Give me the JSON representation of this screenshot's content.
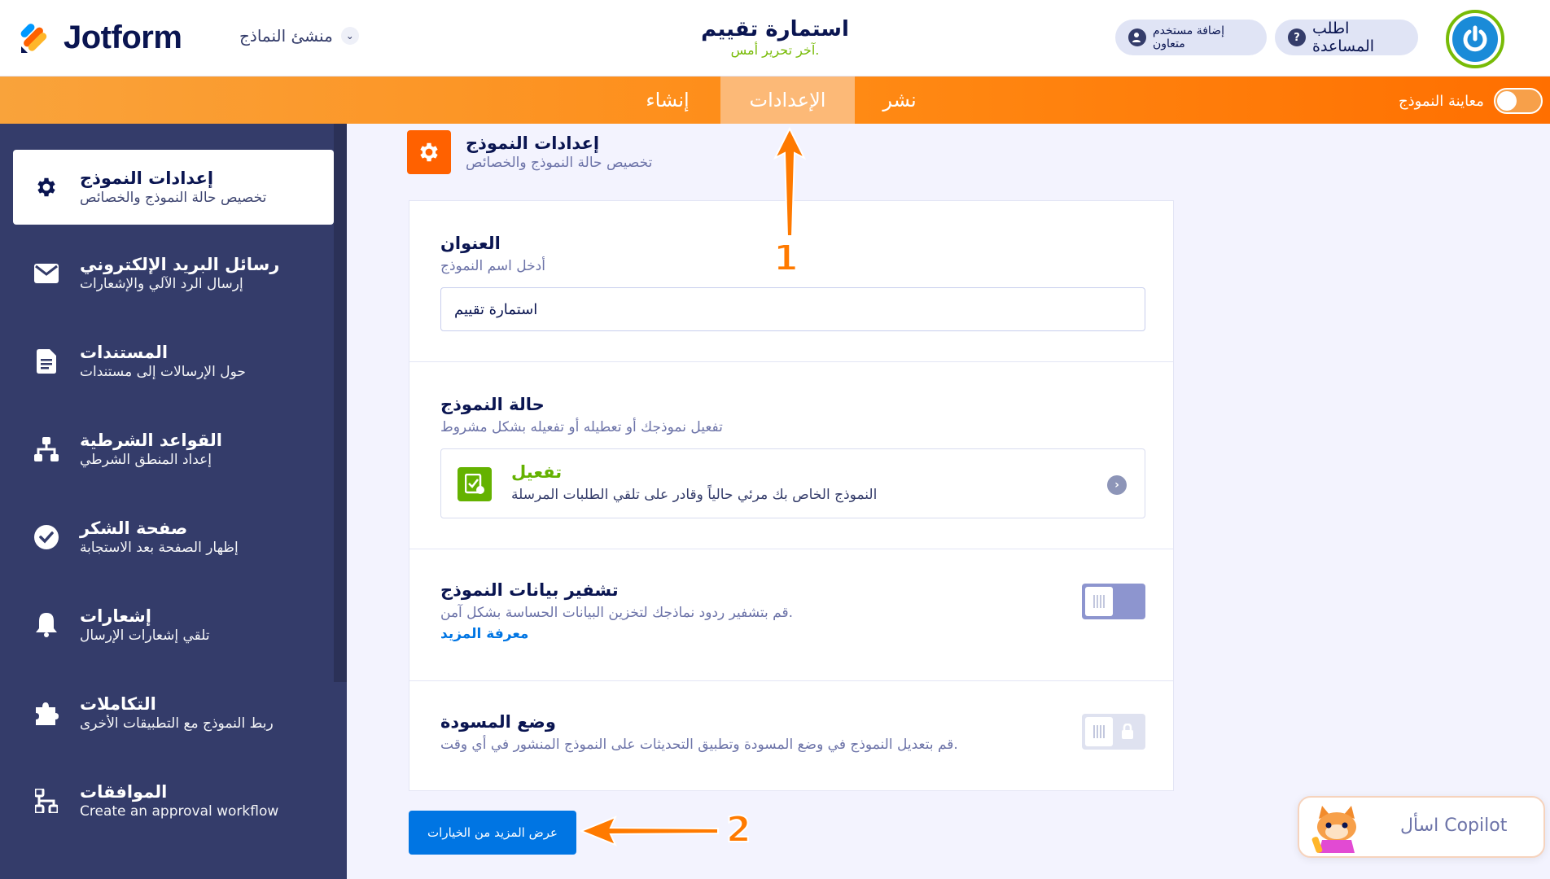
{
  "header": {
    "brand": "Jotform",
    "builder_label": "منشئ النماذج",
    "form_title": "استمارة تقييم",
    "last_edited": "آخر تحرير أمس.",
    "add_collaborator": "إضافة مستخدم متعاون",
    "get_help": "اطلب المساعدة"
  },
  "nav": {
    "tabs": [
      "إنشاء",
      "الإعدادات",
      "نشر"
    ],
    "preview_label": "معاينة النموذج"
  },
  "sidebar": {
    "items": [
      {
        "title": "إعدادات النموذج",
        "desc": "تخصيص حالة النموذج والخصائص",
        "icon": "gear-icon"
      },
      {
        "title": "رسائل البريد الإلكتروني",
        "desc": "إرسال الرد الآلي والإشعارات",
        "icon": "envelope-icon"
      },
      {
        "title": "المستندات",
        "desc": "حول الإرسالات إلى مستندات",
        "icon": "document-icon"
      },
      {
        "title": "القواعد الشرطية",
        "desc": "إعداد المنطق الشرطي",
        "icon": "hierarchy-icon"
      },
      {
        "title": "صفحة الشكر",
        "desc": "إظهار الصفحة بعد الاستجابة",
        "icon": "check-circle-icon"
      },
      {
        "title": "إشعارات",
        "desc": "تلقي إشعارات الإرسال",
        "icon": "bell-icon"
      },
      {
        "title": "التكاملات",
        "desc": "ربط النموذج مع التطبيقات الأخرى",
        "icon": "puzzle-icon"
      },
      {
        "title": "الموافقات",
        "desc": "Create an approval workflow",
        "icon": "workflow-icon"
      }
    ]
  },
  "section": {
    "title": "إعدادات النموذج",
    "desc": "تخصيص حالة النموذج والخصائص"
  },
  "settings": {
    "title_label": "العنوان",
    "title_hint": "أدخل اسم النموذج",
    "title_value": "استمارة تقييم",
    "status_label": "حالة النموذج",
    "status_hint": "تفعيل نموذجك أو تعطيله أو تفعيله بشكل مشروط",
    "status_value": "تفعيل",
    "status_desc": "النموذج الخاص بك مرئي حالياً وقادر على تلقي الطلبات المرسلة",
    "encrypt_label": "تشفير بيانات النموذج",
    "encrypt_desc": "قم بتشفير ردود نماذجك لتخزين البيانات الحساسة بشكل آمن.",
    "learn_more": "معرفة المزيد",
    "draft_label": "وضع المسودة",
    "draft_desc": "قم بتعديل النموذج في وضع المسودة وتطبيق التحديثات على النموذج المنشور في أي وقت."
  },
  "buttons": {
    "show_more": "عرض المزيد من الخيارات",
    "copilot": "اسأل Copilot"
  },
  "annotations": {
    "step1": "1",
    "step2": "2"
  },
  "colors": {
    "accent_orange": "#ff6100",
    "sidebar_bg": "#343c6a",
    "primary_blue": "#0075e3",
    "success_green": "#64b200",
    "toggle_off": "#8d95cf"
  }
}
